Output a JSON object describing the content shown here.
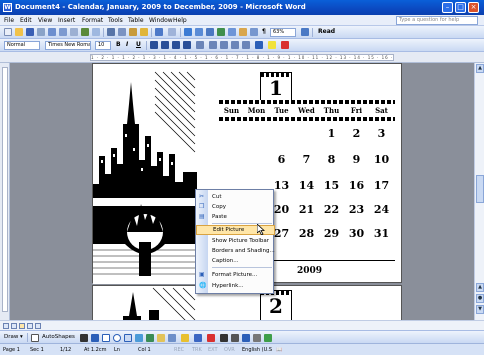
{
  "window": {
    "title": "Document4 - Calendar, January, 2009 to December, 2009 - Microsoft Word",
    "app_icon_letter": "W"
  },
  "menubar": {
    "items": [
      "File",
      "Edit",
      "View",
      "Insert",
      "Format",
      "Tools",
      "Table",
      "Window",
      "Help"
    ],
    "help_placeholder": "Type a question for help"
  },
  "toolbar_standard": {
    "zoom": "63%",
    "read_label": "Read"
  },
  "toolbar_formatting": {
    "style": "Normal",
    "font": "Times New Roman",
    "size": "10",
    "bold": "B",
    "italic": "I",
    "underline": "U"
  },
  "ruler": {
    "ticks": "1 · 2 · 1 · 1 · 2 · 1 · 3 · 1 · 4 · 1 · 5 · 1 · 6 · 1 · 7 · 1 · 8 · 1 · 9 · 1 · 10 · 11 · 12 · 13 · 14 · 15 · 16 · 17 · 18 · 19 · 20 · 21 · 22 · 23 · 24 · 25"
  },
  "calendar": {
    "month_number": "1",
    "next_month_number": "2",
    "year": "2009",
    "days": [
      "Sun",
      "Mon",
      "Tue",
      "Wed",
      "Thu",
      "Fri",
      "Sat"
    ],
    "weeks": [
      [
        "",
        "",
        "",
        "",
        "1",
        "2",
        "3"
      ],
      [
        "",
        "",
        "6",
        "7",
        "8",
        "9",
        "10"
      ],
      [
        "",
        "",
        "13",
        "14",
        "15",
        "16",
        "17"
      ],
      [
        "",
        "",
        "20",
        "21",
        "22",
        "23",
        "24"
      ],
      [
        "25",
        "26",
        "27",
        "28",
        "29",
        "30",
        "31"
      ]
    ]
  },
  "context_menu": {
    "items": [
      {
        "label": "Cut",
        "icon": "scissors-icon"
      },
      {
        "label": "Copy",
        "icon": "copy-icon"
      },
      {
        "label": "Paste",
        "icon": "paste-icon"
      },
      {
        "label": "Edit Picture",
        "icon": ""
      },
      {
        "label": "Show Picture Toolbar",
        "icon": ""
      },
      {
        "label": "Borders and Shading...",
        "icon": ""
      },
      {
        "label": "Caption...",
        "icon": ""
      },
      {
        "label": "Format Picture...",
        "icon": "format-picture-icon"
      },
      {
        "label": "Hyperlink...",
        "icon": "hyperlink-icon"
      }
    ],
    "highlighted_index": 3
  },
  "drawing_toolbar": {
    "draw_label": "Draw",
    "autoshapes_label": "AutoShapes"
  },
  "statusbar": {
    "page": "Page  1",
    "section": "Sec  1",
    "page_of": "1/12",
    "at": "At  1.2cm",
    "ln": "Ln",
    "col": "Col  1",
    "rec": "REC",
    "trk": "TRK",
    "ext": "EXT",
    "ovr": "OVR",
    "language": "English (U.S"
  },
  "colors": {
    "titlebar": "#0b49c0",
    "toolbar": "#c9d9f3",
    "workspace": "#8a8f9a",
    "menu_highlight": "#ffe6a8"
  }
}
